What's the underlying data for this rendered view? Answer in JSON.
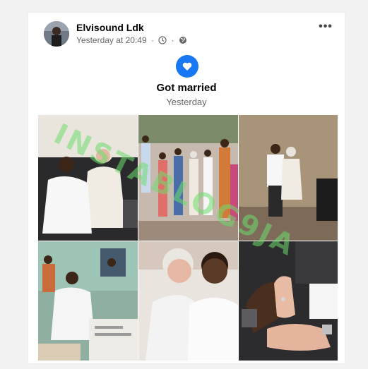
{
  "post": {
    "author": "Elvisound Ldk",
    "timestamp": "Yesterday at 20:49",
    "more_label": "•••",
    "icons": [
      "clock-icon",
      "globe-icon",
      "more-options-icon"
    ]
  },
  "life_event": {
    "icon": "heart-icon",
    "title": "Got married",
    "subtitle": "Yesterday"
  },
  "photos": [
    "couple-seated-sofa",
    "group-photo-outdoors",
    "couple-dancing",
    "signing-register",
    "couple-selfie",
    "hands-with-rings"
  ],
  "watermark": "INSTABLOG9JA",
  "colors": {
    "accent": "#1877f2",
    "watermark": "#6edc6e"
  }
}
